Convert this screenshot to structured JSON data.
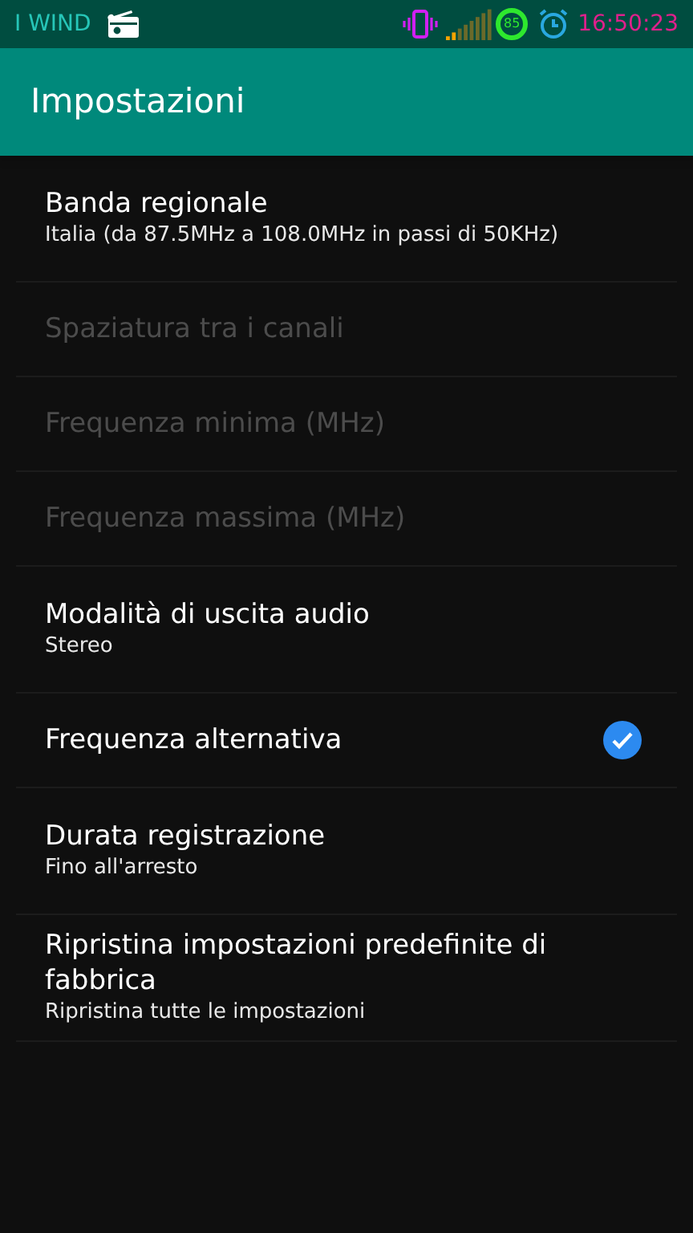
{
  "status_bar": {
    "carrier": "I WIND",
    "battery": "85",
    "time": "16:50:23"
  },
  "app_bar": {
    "title": "Impostazioni"
  },
  "settings": [
    {
      "kind": "text",
      "title": "Banda regionale",
      "summary": "Italia (da 87.5MHz a 108.0MHz in passi di 50KHz)",
      "disabled": false
    },
    {
      "kind": "text",
      "title": "Spaziatura tra i canali",
      "disabled": true
    },
    {
      "kind": "text",
      "title": "Frequenza minima (MHz)",
      "disabled": true
    },
    {
      "kind": "text",
      "title": "Frequenza massima (MHz)",
      "disabled": true
    },
    {
      "kind": "text",
      "title": "Modalità di uscita audio",
      "summary": "Stereo",
      "disabled": false
    },
    {
      "kind": "checkbox",
      "title": "Frequenza alternativa",
      "checked": true,
      "disabled": false
    },
    {
      "kind": "text",
      "title": "Durata registrazione",
      "summary": "Fino all'arresto",
      "disabled": false
    },
    {
      "kind": "text",
      "title": "Ripristina impostazioni predefinite di fabbrica",
      "summary": "Ripristina tutte le impostazioni",
      "disabled": false
    }
  ]
}
